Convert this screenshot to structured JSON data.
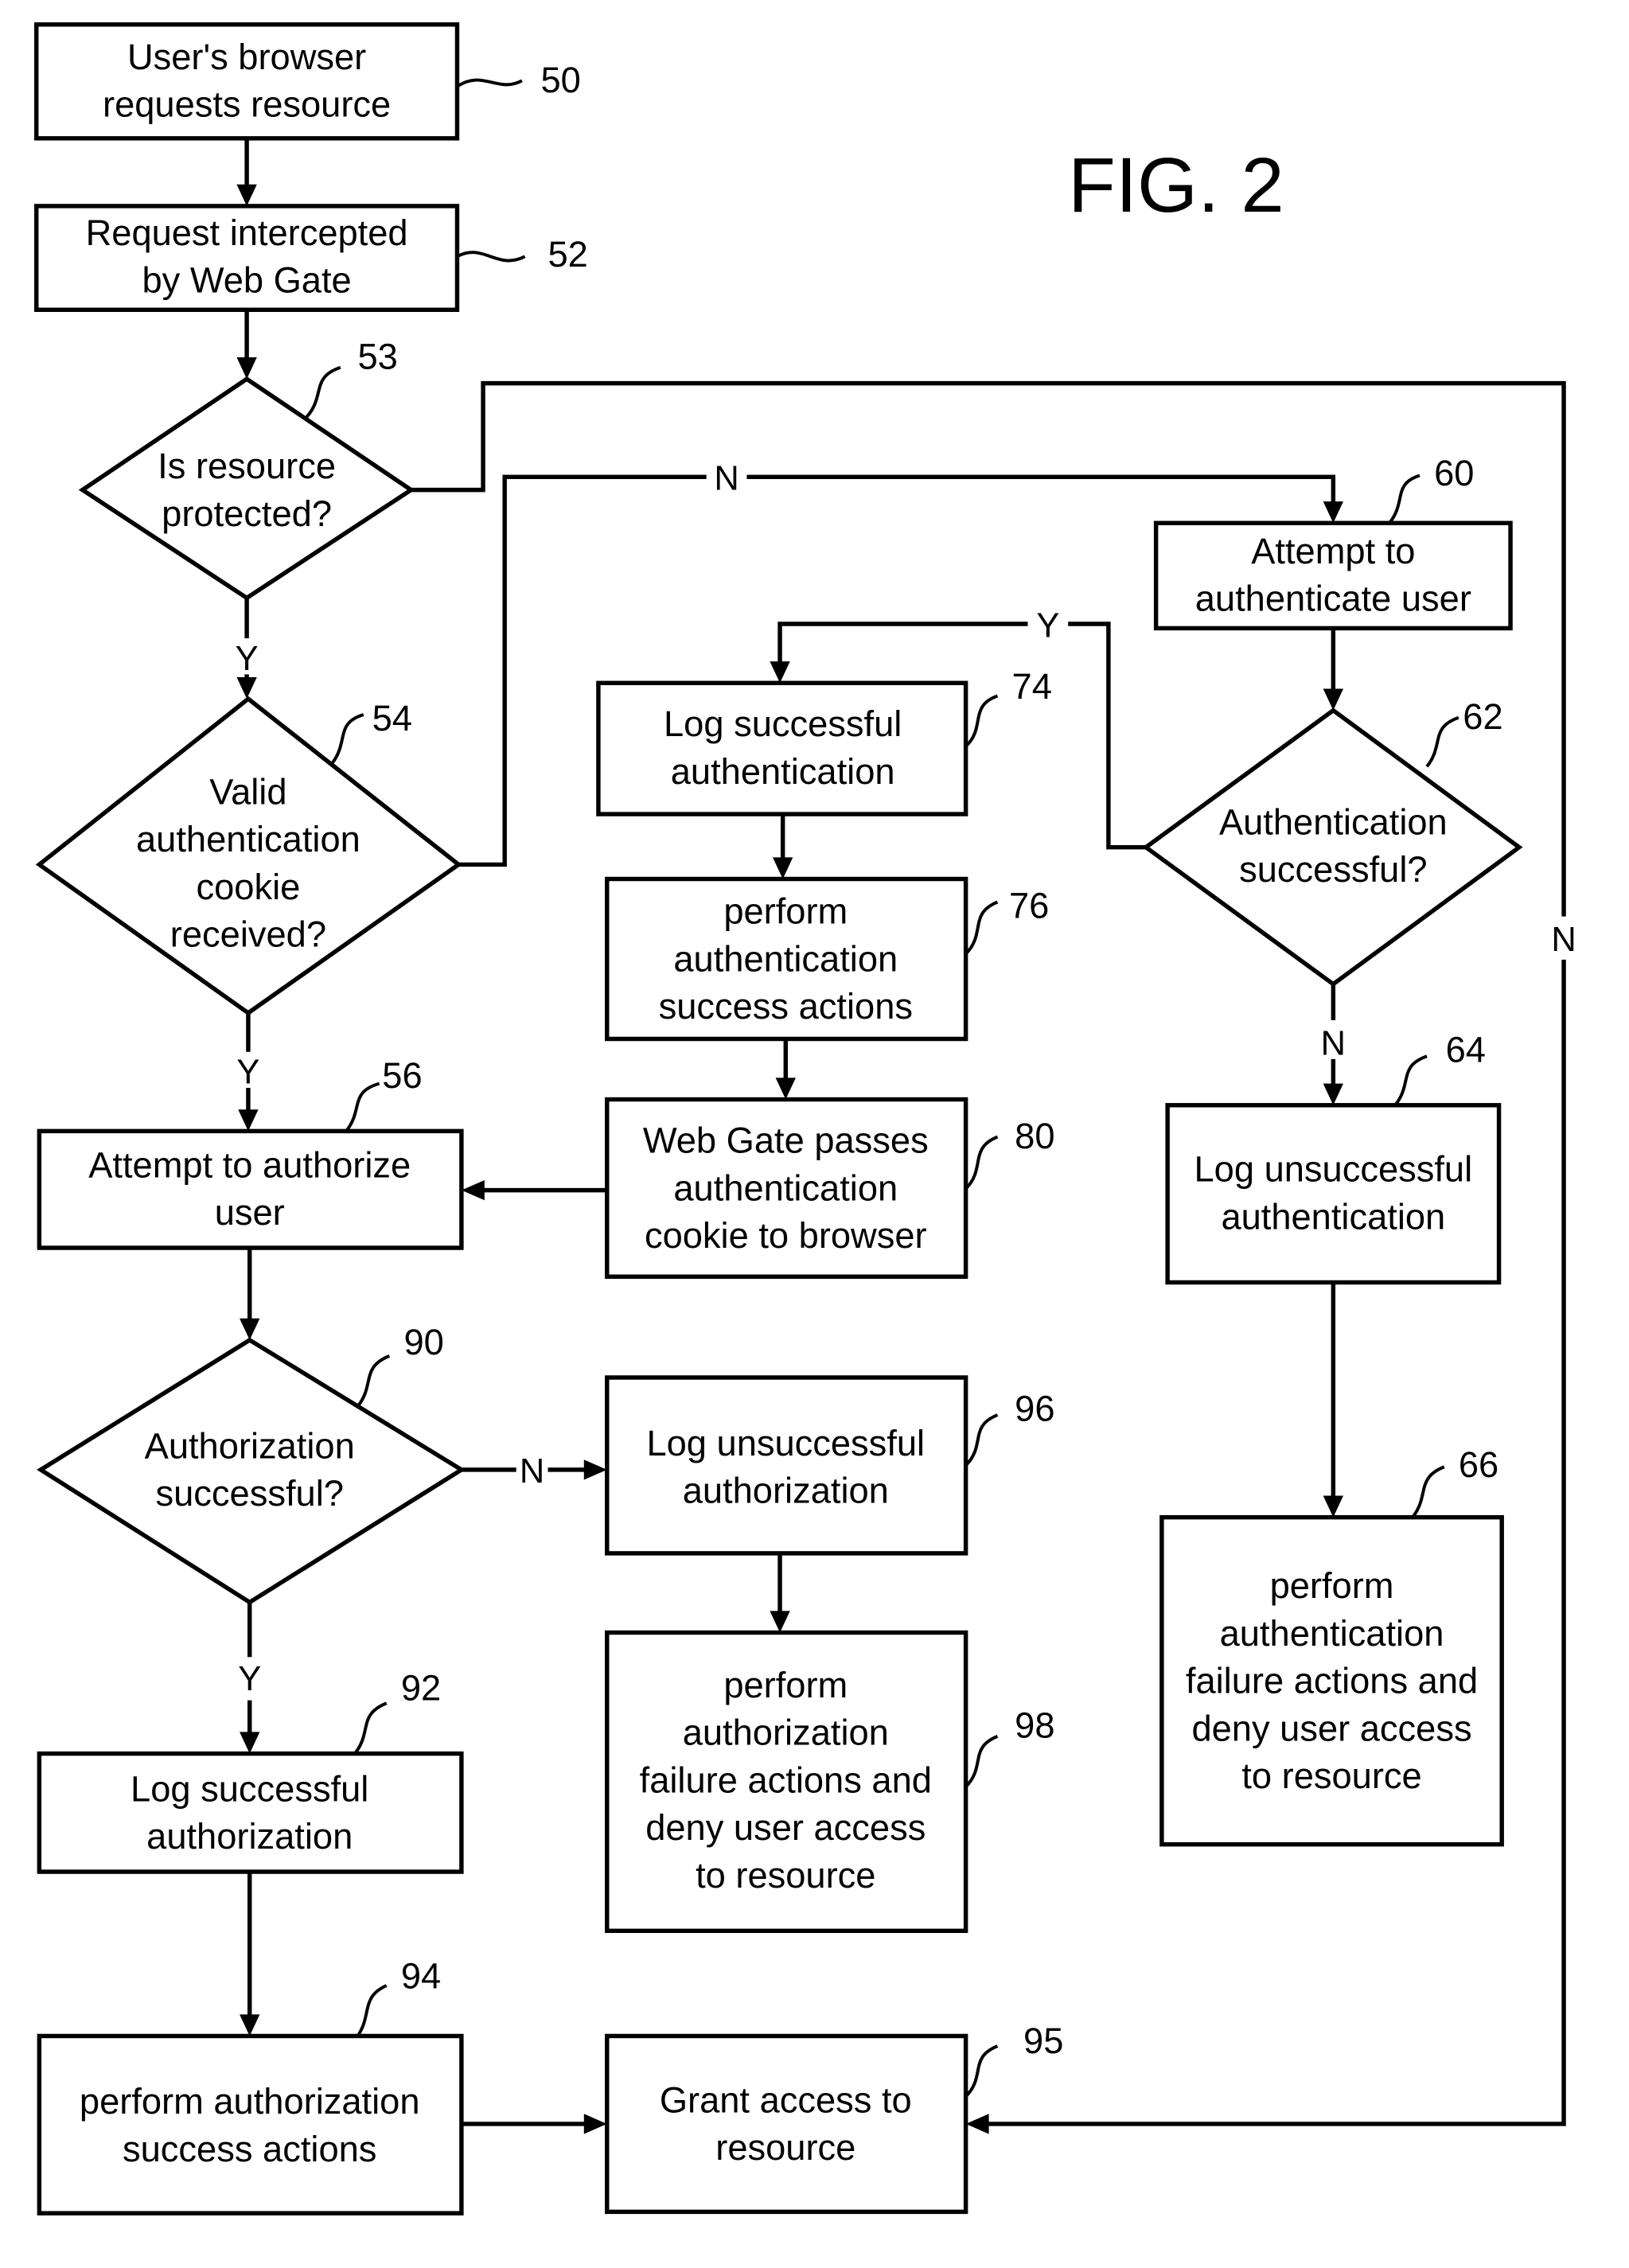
{
  "figure": {
    "title": "FIG. 2"
  },
  "nodes": {
    "n50": {
      "ref": "50",
      "type": "process",
      "lines": [
        "User's browser",
        "requests resource"
      ]
    },
    "n52": {
      "ref": "52",
      "type": "process",
      "lines": [
        "Request intercepted",
        "by Web Gate"
      ]
    },
    "n53": {
      "ref": "53",
      "type": "decision",
      "lines": [
        "Is resource",
        "protected?"
      ]
    },
    "n54": {
      "ref": "54",
      "type": "decision",
      "lines": [
        "Valid",
        "authentication",
        "cookie",
        "received?"
      ]
    },
    "n56": {
      "ref": "56",
      "type": "process",
      "lines": [
        "Attempt to authorize",
        "user"
      ]
    },
    "n60": {
      "ref": "60",
      "type": "process",
      "lines": [
        "Attempt to",
        "authenticate user"
      ]
    },
    "n62": {
      "ref": "62",
      "type": "decision",
      "lines": [
        "Authentication",
        "successful?"
      ]
    },
    "n64": {
      "ref": "64",
      "type": "process",
      "lines": [
        "Log unsuccessful",
        "authentication"
      ]
    },
    "n66": {
      "ref": "66",
      "type": "process",
      "lines": [
        "perform",
        "authentication",
        "failure actions and",
        "deny user access",
        "to resource"
      ]
    },
    "n74": {
      "ref": "74",
      "type": "process",
      "lines": [
        "Log successful",
        "authentication"
      ]
    },
    "n76": {
      "ref": "76",
      "type": "process",
      "lines": [
        "perform",
        "authentication",
        "success actions"
      ]
    },
    "n80": {
      "ref": "80",
      "type": "process",
      "lines": [
        "Web Gate passes",
        "authentication",
        "cookie to browser"
      ]
    },
    "n90": {
      "ref": "90",
      "type": "decision",
      "lines": [
        "Authorization",
        "successful?"
      ]
    },
    "n92": {
      "ref": "92",
      "type": "process",
      "lines": [
        "Log successful",
        "authorization"
      ]
    },
    "n94": {
      "ref": "94",
      "type": "process",
      "lines": [
        "perform authorization",
        "success actions"
      ]
    },
    "n95": {
      "ref": "95",
      "type": "process",
      "lines": [
        "Grant access to",
        "resource"
      ]
    },
    "n96": {
      "ref": "96",
      "type": "process",
      "lines": [
        "Log unsuccessful",
        "authorization"
      ]
    },
    "n98": {
      "ref": "98",
      "type": "process",
      "lines": [
        "perform",
        "authorization",
        "failure actions and",
        "deny user access",
        "to resource"
      ]
    }
  },
  "edges": [
    {
      "from": "50",
      "to": "52",
      "label": ""
    },
    {
      "from": "52",
      "to": "53",
      "label": ""
    },
    {
      "from": "53",
      "to": "54",
      "label": "Y"
    },
    {
      "from": "53",
      "to": "95",
      "label": "N"
    },
    {
      "from": "54",
      "to": "56",
      "label": "Y"
    },
    {
      "from": "54",
      "to": "60",
      "label": "N"
    },
    {
      "from": "60",
      "to": "62",
      "label": ""
    },
    {
      "from": "62",
      "to": "74",
      "label": "Y"
    },
    {
      "from": "62",
      "to": "64",
      "label": "N"
    },
    {
      "from": "64",
      "to": "66",
      "label": ""
    },
    {
      "from": "74",
      "to": "76",
      "label": ""
    },
    {
      "from": "76",
      "to": "80",
      "label": ""
    },
    {
      "from": "80",
      "to": "56",
      "label": ""
    },
    {
      "from": "56",
      "to": "90",
      "label": ""
    },
    {
      "from": "90",
      "to": "92",
      "label": "Y"
    },
    {
      "from": "90",
      "to": "96",
      "label": "N"
    },
    {
      "from": "96",
      "to": "98",
      "label": ""
    },
    {
      "from": "92",
      "to": "94",
      "label": ""
    },
    {
      "from": "94",
      "to": "95",
      "label": ""
    }
  ],
  "labels": {
    "yes": "Y",
    "no": "N"
  }
}
